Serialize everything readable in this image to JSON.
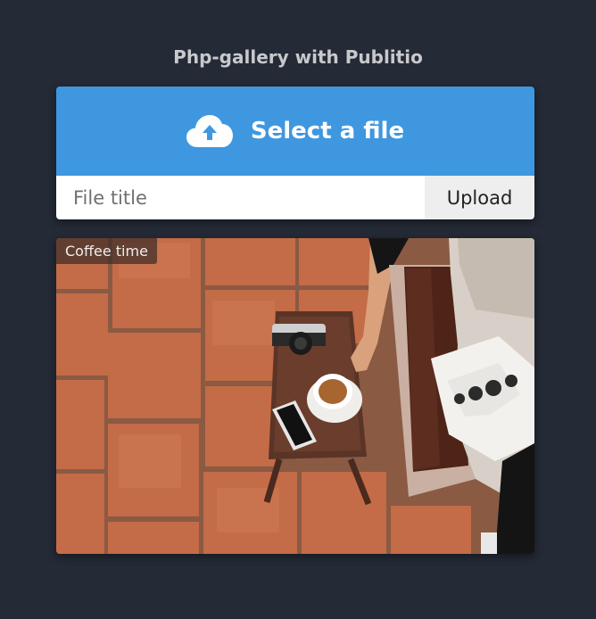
{
  "header": {
    "title": "Php-gallery with Publitio"
  },
  "uploader": {
    "select_label": "Select a file",
    "title_placeholder": "File title",
    "title_value": "",
    "upload_label": "Upload",
    "icon": "cloud-upload-icon",
    "accent_color": "#3f97df"
  },
  "gallery": {
    "items": [
      {
        "caption": "Coffee time"
      }
    ]
  }
}
